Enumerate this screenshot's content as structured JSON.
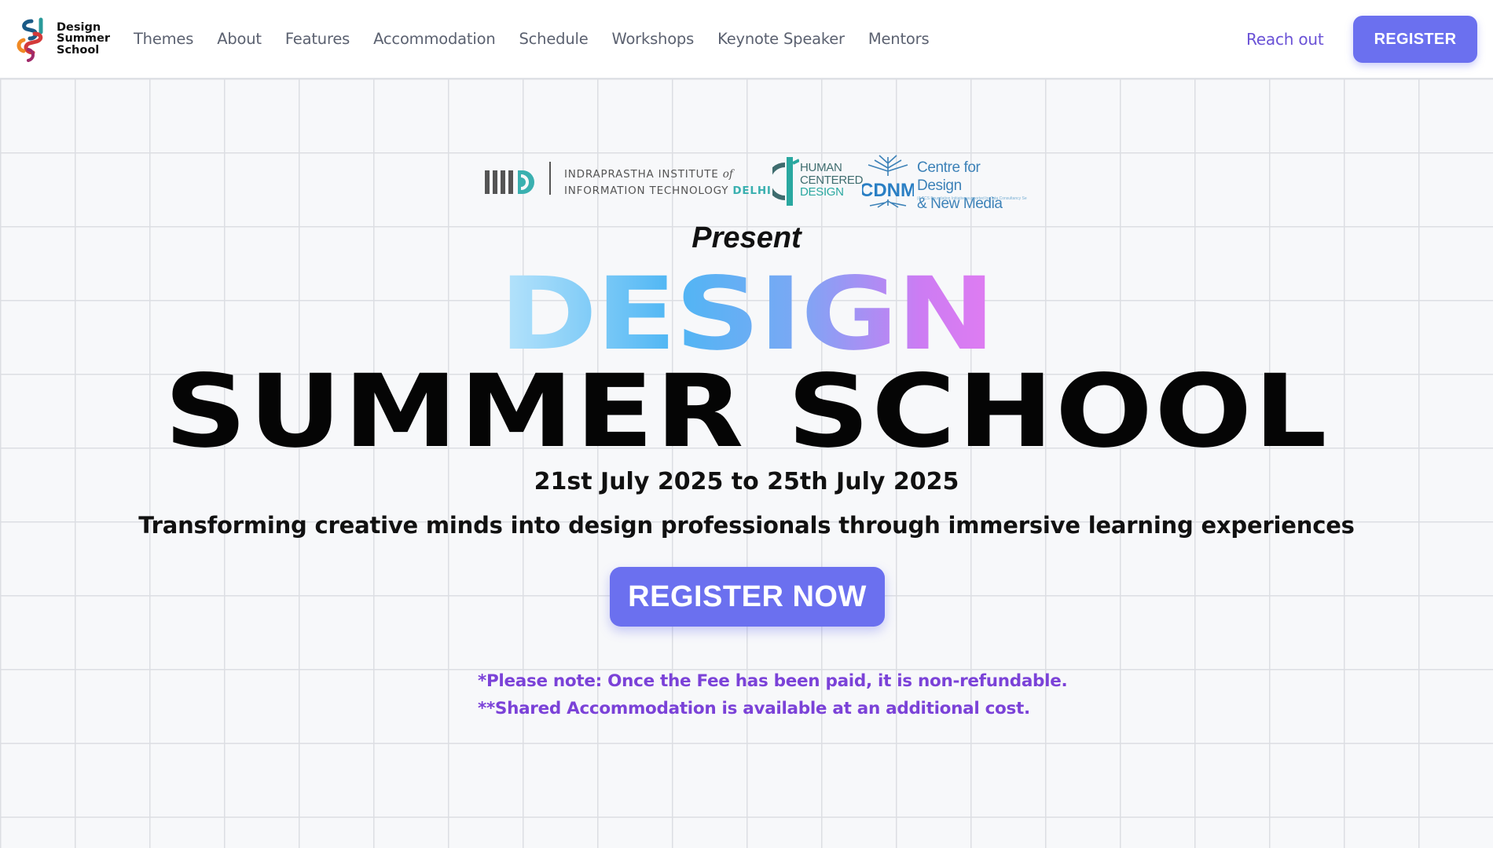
{
  "header": {
    "brand_lines": [
      "Design",
      "Summer",
      "School"
    ],
    "nav": [
      "Themes",
      "About",
      "Features",
      "Accommodation",
      "Schedule",
      "Workshops",
      "Keynote Speaker",
      "Mentors"
    ],
    "reach_out": "Reach out",
    "register": "REGISTER"
  },
  "sponsors": {
    "iiitd_line1": "INDRAPRASTHA INSTITUTE",
    "iiitd_of": "of",
    "iiitd_line2": "INFORMATION TECHNOLOGY",
    "iiitd_delhi": "DELHI",
    "hcd_line1": "HUMAN",
    "hcd_line2": "CENTERED",
    "hcd_line3": "DESIGN",
    "cdnm_mark": "CDNM",
    "cdnm_line1": "Centre for Design",
    "cdnm_line2": "& New Media",
    "cdnm_fine": "(A TCS Foundation Initiative supported by Tata Consultancy Services)"
  },
  "hero": {
    "present": "Present",
    "design": "DESIGN",
    "summer_school": "SUMMER SCHOOL",
    "dates": "21st July 2025 to 25th July 2025",
    "tagline": "Transforming creative minds into design professionals through immersive learning experiences",
    "cta": "REGISTER NOW",
    "note1": "*Please note: Once the Fee has been paid, it is non-refundable.",
    "note2": "**Shared Accommodation is available at an additional cost."
  },
  "colors": {
    "accent": "#6b70ef",
    "note": "#7b42d8",
    "link": "#6a52d6",
    "gradient": [
      "#b8e4fb",
      "#4fb6f4",
      "#cc7cf3",
      "#e07cf1"
    ]
  }
}
